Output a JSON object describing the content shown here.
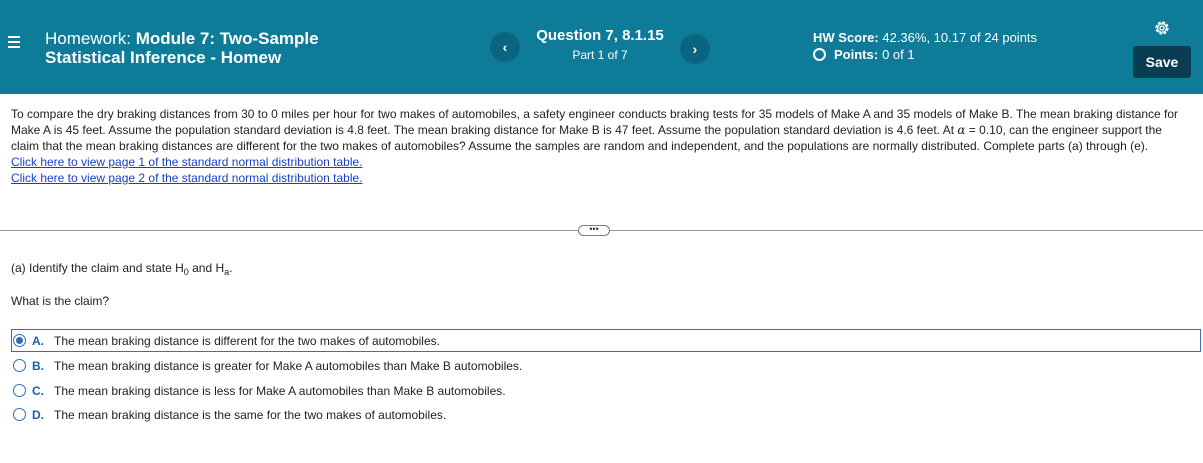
{
  "header": {
    "title_prefix": "Homework: ",
    "title_name_line1": "Module 7: Two-Sample",
    "title_name_line2": "Statistical Inference - Homew",
    "prev_label": "‹",
    "next_label": "›",
    "question_title": "Question 7, 8.1.15",
    "question_part": "Part 1 of 7",
    "score_label": "HW Score:",
    "score_value": "42.36%, 10.17 of 24 points",
    "points_label": "Points:",
    "points_value": "0 of 1",
    "save_label": "Save",
    "colors": {
      "bar": "#0e7c99",
      "save": "#0a3c52"
    }
  },
  "problem": {
    "text_part1": "To compare the dry braking distances from 30 to 0 miles per hour for two makes of automobiles, a safety engineer conducts braking tests for 35 models of Make A and 35 models of Make B. The mean braking distance for Make A is 45 feet. Assume the population standard deviation is 4.8 feet. The mean braking distance for Make B is 47 feet. Assume the population standard deviation is 4.6 feet. At ",
    "alpha_symbol": "α",
    "text_part2": " = 0.10, can the engineer support the claim that the mean braking distances are different for the two makes of automobiles? Assume the samples are random and independent, and the populations are normally distributed. Complete parts (a) through (e).",
    "links": [
      "Click here to view page 1 of the standard normal distribution table.",
      "Click here to view page 2 of the standard normal distribution table."
    ]
  },
  "expand_label": "•••",
  "part_a": {
    "label_start": "(a) Identify the claim and state H",
    "sub0": "0",
    "label_mid": " and H",
    "suba": "a",
    "label_end": ".",
    "question": "What is the claim?"
  },
  "options": [
    {
      "letter": "A.",
      "text": "The mean braking distance is different for the two makes of automobiles."
    },
    {
      "letter": "B.",
      "text": "The mean braking distance is greater for Make A automobiles than Make B automobiles."
    },
    {
      "letter": "C.",
      "text": "The mean braking distance is less for Make A automobiles than Make B automobiles."
    },
    {
      "letter": "D.",
      "text": "The mean braking distance is the same for the two makes of automobiles."
    }
  ],
  "selected_option": "A."
}
